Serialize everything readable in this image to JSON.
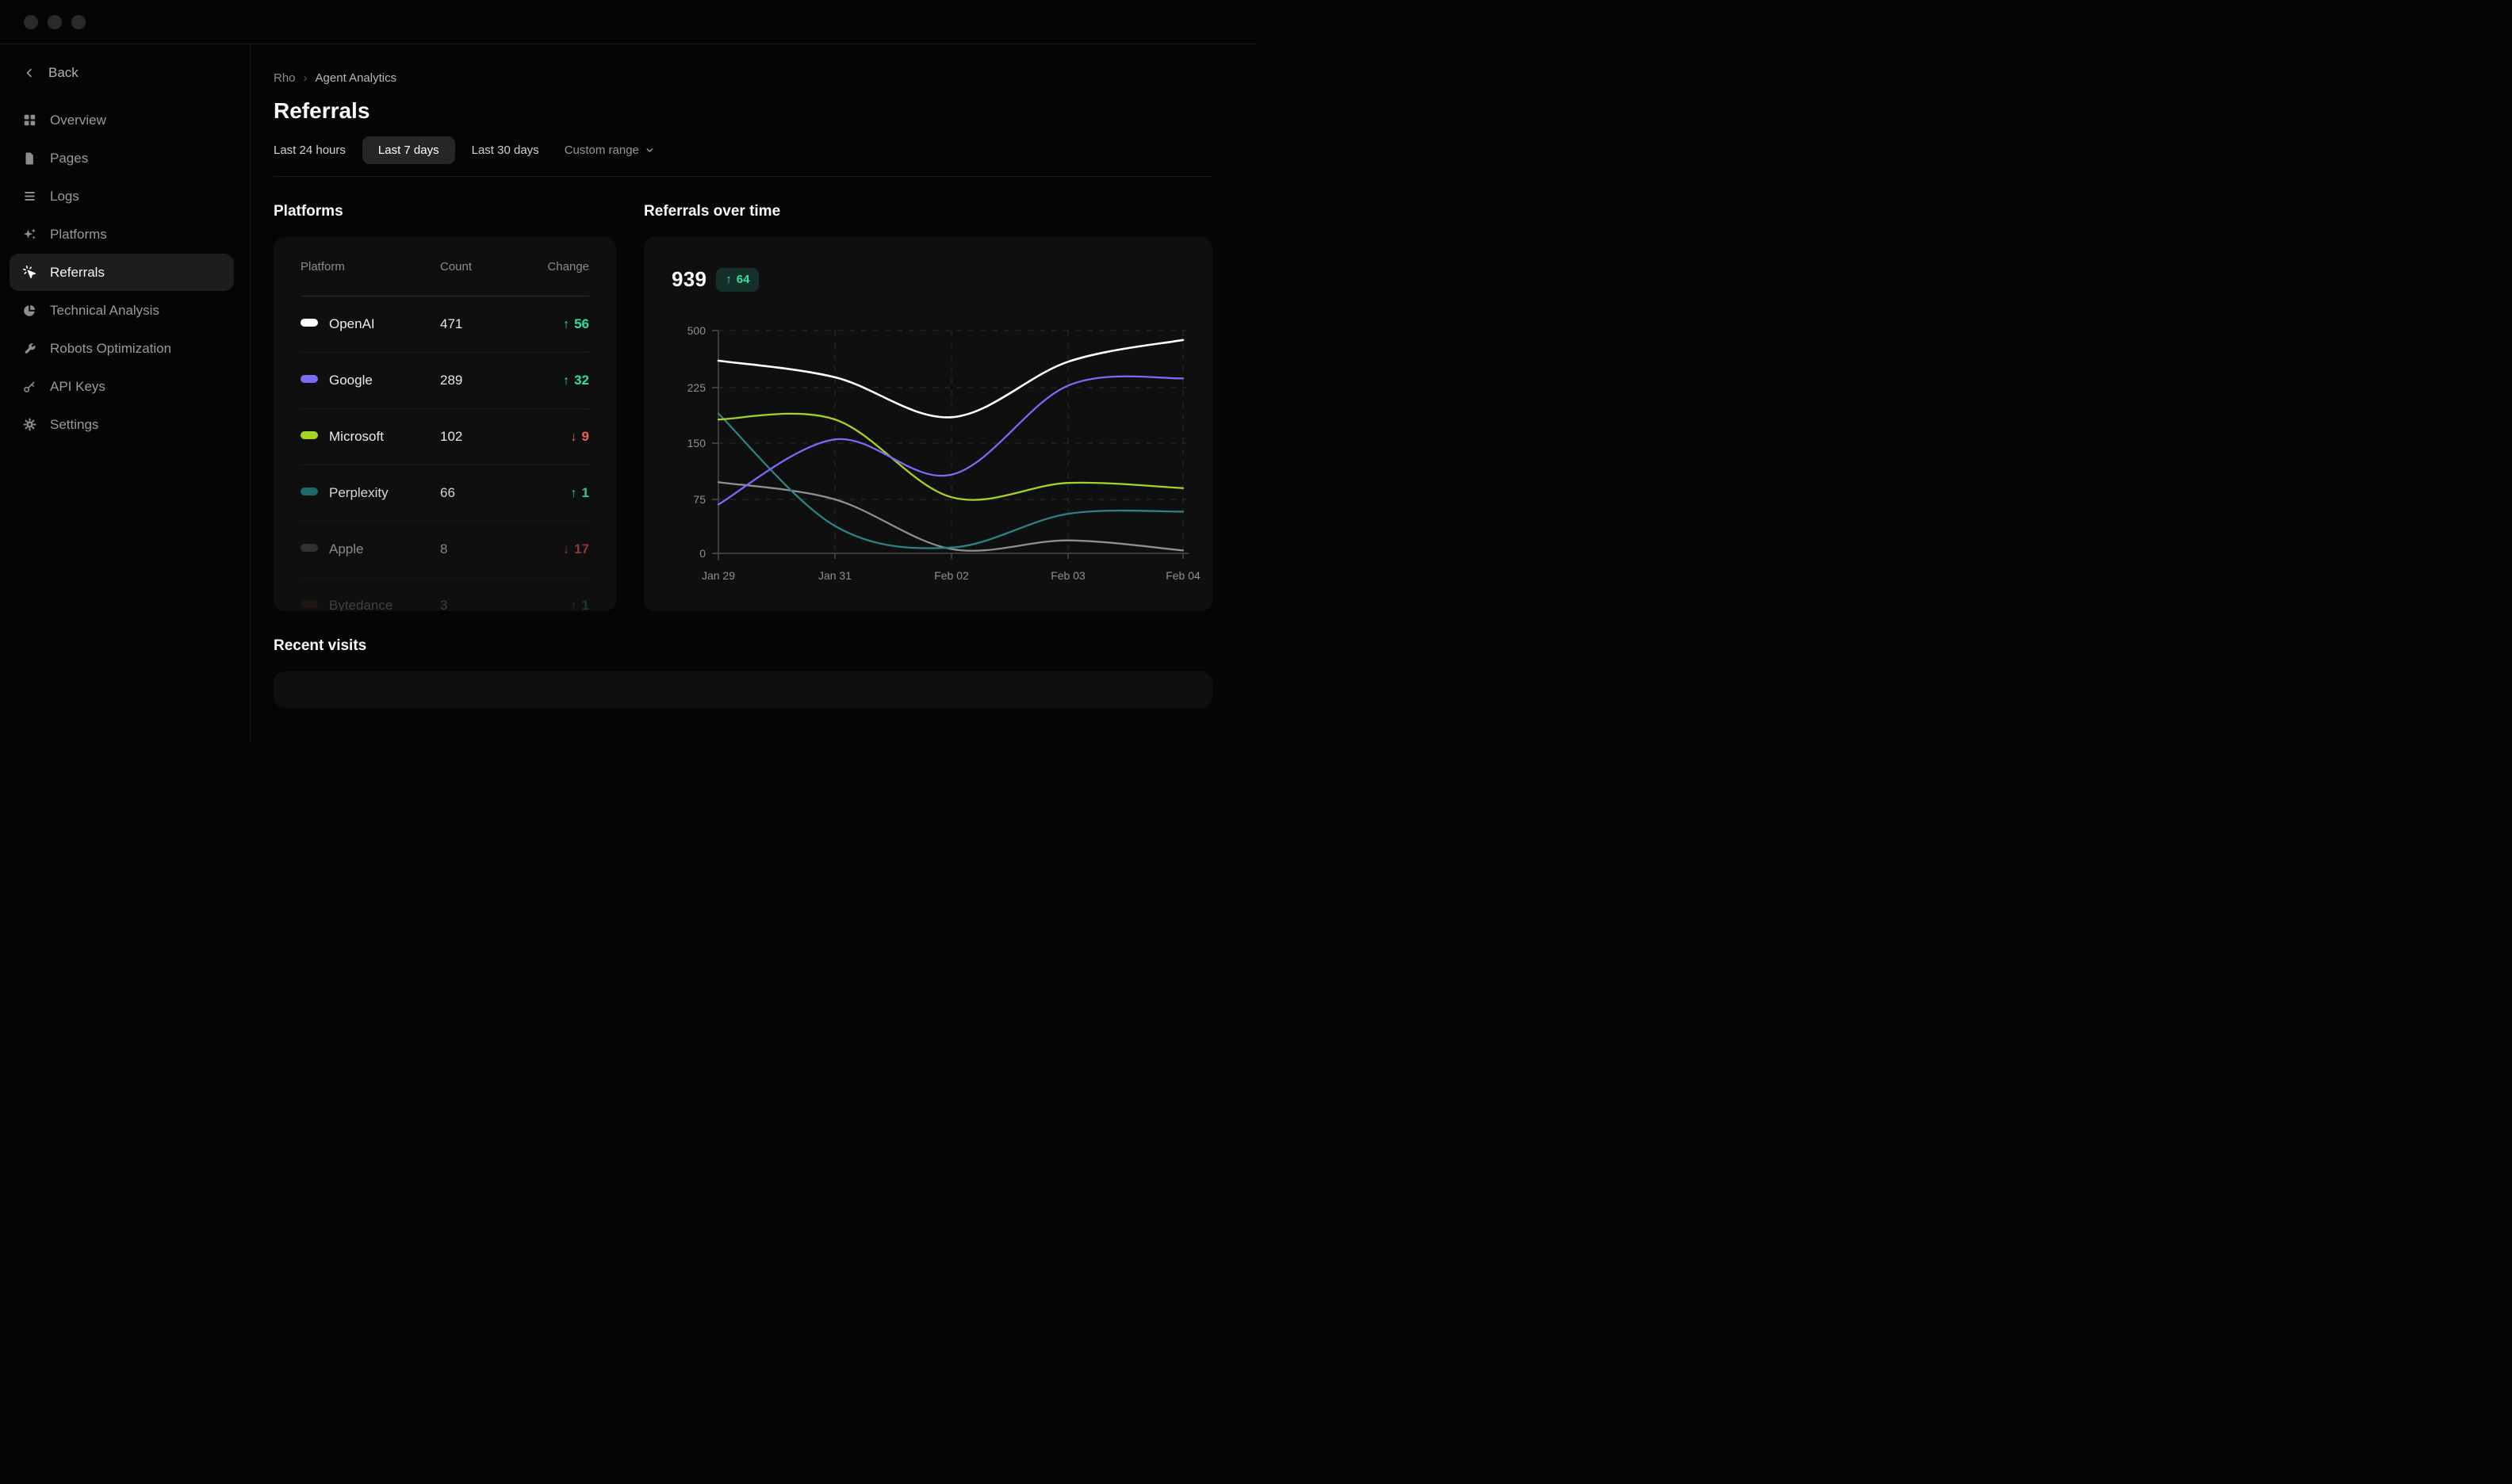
{
  "window": {
    "controls": [
      "window-dot-1",
      "window-dot-2",
      "window-dot-3"
    ]
  },
  "sidebar": {
    "back_label": "Back",
    "items": [
      {
        "label": "Overview",
        "icon": "grid-icon",
        "active": false
      },
      {
        "label": "Pages",
        "icon": "document-icon",
        "active": false
      },
      {
        "label": "Logs",
        "icon": "logs-icon",
        "active": false
      },
      {
        "label": "Platforms",
        "icon": "sparkles-icon",
        "active": false
      },
      {
        "label": "Referrals",
        "icon": "pointer-click-icon",
        "active": true
      },
      {
        "label": "Technical Analysis",
        "icon": "pie-chart-icon",
        "active": false
      },
      {
        "label": "Robots Optimization",
        "icon": "wrench-icon",
        "active": false
      },
      {
        "label": "API Keys",
        "icon": "key-icon",
        "active": false
      },
      {
        "label": "Settings",
        "icon": "gear-icon",
        "active": false
      }
    ]
  },
  "header": {
    "breadcrumb": {
      "root": "Rho",
      "separator": "›",
      "current": "Agent Analytics"
    },
    "title": "Referrals",
    "time_ranges": [
      {
        "label": "Last 24 hours",
        "selected": false,
        "muted": false
      },
      {
        "label": "Last 7 days",
        "selected": true,
        "muted": false
      },
      {
        "label": "Last 30 days",
        "selected": false,
        "muted": false
      },
      {
        "label": "Custom range",
        "selected": false,
        "muted": true,
        "has_chevron": true
      }
    ]
  },
  "platforms": {
    "heading": "Platforms",
    "columns": [
      "Platform",
      "Count",
      "Change"
    ],
    "rows": [
      {
        "name": "OpenAI",
        "color": "#ffffff",
        "count": "471",
        "change": "56",
        "direction": "up",
        "opacity": 1
      },
      {
        "name": "Google",
        "color": "#7a6bf5",
        "count": "289",
        "change": "32",
        "direction": "up",
        "opacity": 1
      },
      {
        "name": "Microsoft",
        "color": "#a3d325",
        "count": "102",
        "change": "9",
        "direction": "down",
        "opacity": 1
      },
      {
        "name": "Perplexity",
        "color": "#1f7378",
        "count": "66",
        "change": "1",
        "direction": "up",
        "opacity": 0.9
      },
      {
        "name": "Apple",
        "color": "#4f4f4f",
        "count": "8",
        "change": "17",
        "direction": "down",
        "opacity": 0.55
      },
      {
        "name": "Bytedance",
        "color": "#67312c",
        "count": "3",
        "change": "1",
        "direction": "up",
        "opacity": 0.22
      }
    ]
  },
  "chart": {
    "heading": "Referrals over time",
    "total": "939",
    "delta": "64",
    "delta_arrow": "↑",
    "badge_bg": "#15302a",
    "badge_color": "#34e3a1"
  },
  "chart_data": {
    "type": "line",
    "title": "Referrals over time",
    "x": [
      "Jan 29",
      "Jan 31",
      "Feb 02",
      "Feb 03",
      "Feb 04"
    ],
    "y_ticks": [
      0,
      75,
      150,
      225,
      500
    ],
    "grid": "dashed",
    "legend": "none",
    "series": [
      {
        "name": "OpenAI",
        "color": "#ffffff",
        "values": [
          355,
          275,
          185,
          350,
          455
        ]
      },
      {
        "name": "Google",
        "color": "#7a6bf5",
        "values": [
          68,
          155,
          108,
          235,
          270
        ]
      },
      {
        "name": "Microsoft",
        "color": "#a3d325",
        "values": [
          182,
          182,
          78,
          97,
          90
        ]
      },
      {
        "name": "Perplexity",
        "color": "#2b8287",
        "values": [
          190,
          38,
          8,
          55,
          58
        ]
      },
      {
        "name": "Apple",
        "color": "#8f8f8f",
        "values": [
          98,
          75,
          6,
          18,
          4
        ]
      }
    ]
  },
  "recent": {
    "heading": "Recent visits"
  }
}
